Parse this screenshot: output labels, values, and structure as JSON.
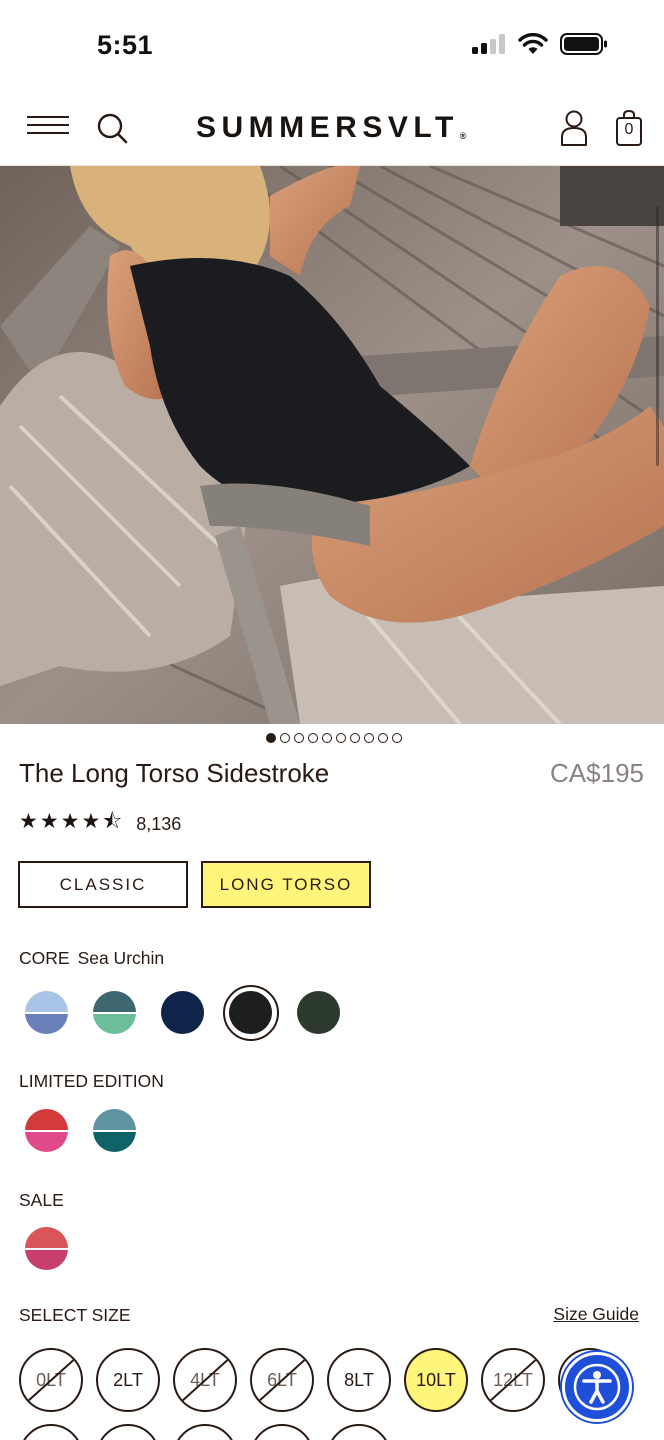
{
  "status_bar": {
    "time": "5:51"
  },
  "header": {
    "menu_icon": "hamburger-icon",
    "search_icon": "search-icon",
    "logo": "SUMMERSVLT",
    "logo_mark": "®",
    "account_icon": "user-icon",
    "cart_icon": "shopping-bag-icon",
    "cart_count": "0"
  },
  "carousel": {
    "total": 10,
    "active": 1
  },
  "product": {
    "title": "The Long Torso Sidestroke",
    "price": "CA$195",
    "stars": "★★★★⯪",
    "rating": 4.5,
    "review_count": "8,136"
  },
  "fit_options": [
    {
      "label": "CLASSIC",
      "selected": false
    },
    {
      "label": "LONG TORSO",
      "selected": true
    }
  ],
  "core": {
    "label": "CORE",
    "selected_color": "Sea Urchin",
    "swatches": [
      {
        "top": "#a8c4e6",
        "bottom": "#6b7fba",
        "split": true
      },
      {
        "top": "#3d6670",
        "bottom": "#6cbd9a",
        "split": true
      },
      {
        "top": "#102348",
        "bottom": "#102348",
        "split": false
      },
      {
        "top": "#1e1e1e",
        "bottom": "#1e1e1e",
        "split": false,
        "selected": true
      },
      {
        "top": "#2b3a2d",
        "bottom": "#2b3a2d",
        "split": false
      }
    ]
  },
  "limited": {
    "label": "LIMITED EDITION",
    "swatches": [
      {
        "top": "#d33a3c",
        "bottom": "#e04a8a",
        "split": true
      },
      {
        "top": "#5e95a0",
        "bottom": "#0f6368",
        "split": true
      }
    ]
  },
  "sale": {
    "label": "SALE",
    "swatches": [
      {
        "top": "#d9555a",
        "bottom": "#c73f6a",
        "split": true
      }
    ]
  },
  "sizes": {
    "label": "SELECT SIZE",
    "guide_link": "Size Guide",
    "options": [
      {
        "label": "0LT",
        "available": false
      },
      {
        "label": "2LT",
        "available": true
      },
      {
        "label": "4LT",
        "available": false
      },
      {
        "label": "6LT",
        "available": false
      },
      {
        "label": "8LT",
        "available": true
      },
      {
        "label": "10LT",
        "available": true,
        "selected": true
      },
      {
        "label": "12LT",
        "available": false
      }
    ]
  },
  "accessibility_button": {
    "icon": "accessibility-icon"
  },
  "colors": {
    "accent_yellow": "#fef57a",
    "text": "#2a1a14",
    "accessibility_blue": "#1f4ed8"
  }
}
